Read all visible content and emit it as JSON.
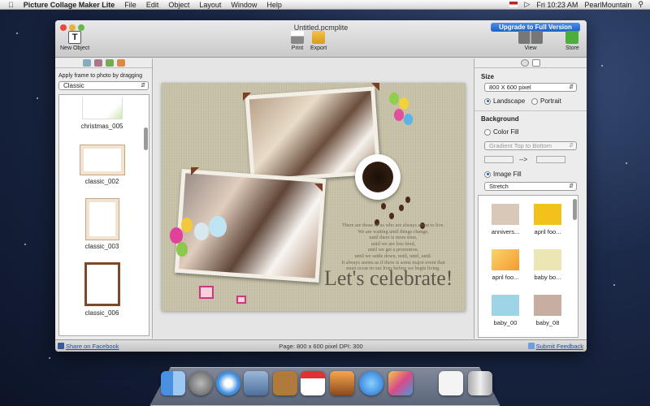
{
  "menubar": {
    "app_name": "Picture Collage Maker Lite",
    "menus": [
      "File",
      "Edit",
      "Object",
      "Layout",
      "Window",
      "Help"
    ],
    "clock": "Fri 10:23 AM",
    "user": "PearlMountain"
  },
  "window": {
    "title": "Untitled.pcmplite",
    "upgrade_label": "Upgrade to Full Version",
    "toolbar": {
      "new_object": "New Object",
      "print": "Print",
      "export": "Export",
      "view": "View",
      "store": "Store"
    }
  },
  "left_panel": {
    "hint": "Apply frame to photo by dragging",
    "category": "Classic",
    "frames": [
      "christmas_005",
      "classic_002",
      "classic_003",
      "classic_006"
    ]
  },
  "canvas": {
    "poem_lines": [
      "There are those of us who are always about to live.",
      "We are waiting until things change,",
      "until there is more time,",
      "until we are less tired,",
      "until we get a promotion,",
      "until we settle down, until, until, until.",
      "It always seems as if there is some major event that",
      "must occur in our lives before we begin living."
    ],
    "headline": "Let's celebrate!"
  },
  "right_panel": {
    "size_label": "Size",
    "size_value": "800 X 600 pixel",
    "orientation": {
      "landscape": "Landscape",
      "portrait": "Portrait",
      "selected": "landscape"
    },
    "background_label": "Background",
    "color_fill": "Color Fill",
    "gradient_value": "Gradient Top to Bottom",
    "arrow": "-->",
    "image_fill": "Image Fill",
    "fill_mode": "Stretch",
    "backgrounds": [
      {
        "name": "annivers...",
        "color": "#d9c7b8"
      },
      {
        "name": "april foo...",
        "color": "#f2c11a"
      },
      {
        "name": "april foo...",
        "color": "#f6a640"
      },
      {
        "name": "baby bo...",
        "color": "#ece6b4"
      },
      {
        "name": "baby_00",
        "color": "#9fd4e6"
      },
      {
        "name": "baby_08",
        "color": "#c8aea0"
      }
    ]
  },
  "statusbar": {
    "share": "Share on Facebook",
    "page_info": "Page: 800 x 600 pixel DPI: 300",
    "feedback": "Submit Feedback"
  },
  "colors": {
    "accent": "#1e5fc8",
    "frame_brown": "#7a3f24"
  },
  "dock": {
    "icons": [
      "finder-icon",
      "launchpad-icon",
      "safari-icon",
      "mail-icon",
      "address-book-icon",
      "calendar-icon",
      "iphoto-icon",
      "app-store-icon",
      "photo-collage-icon",
      "preview-icon",
      "trash-icon"
    ]
  }
}
